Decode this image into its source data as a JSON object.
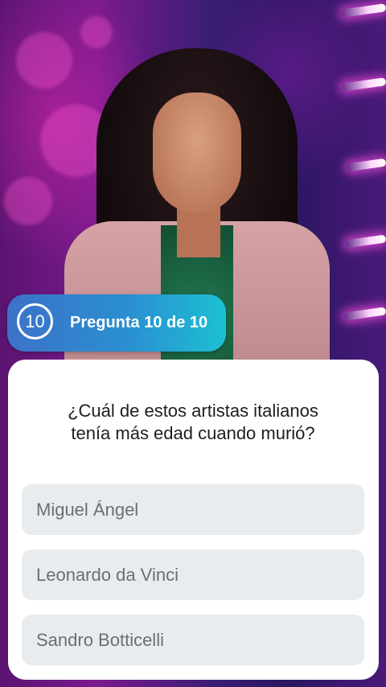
{
  "badge": {
    "counter": "10",
    "label": "Pregunta 10 de 10"
  },
  "question": {
    "line1": "¿Cuál de estos artistas italianos",
    "line2": "tenía más edad cuando murió?"
  },
  "options": [
    {
      "label": "Miguel Ángel"
    },
    {
      "label": "Leonardo da Vinci"
    },
    {
      "label": "Sandro Botticelli"
    }
  ],
  "colors": {
    "badge_start": "#3c72c9",
    "badge_end": "#1cc0d4",
    "option_bg": "#e9ecef",
    "option_text": "#6a6f75",
    "question_text": "#1e1e1e"
  }
}
